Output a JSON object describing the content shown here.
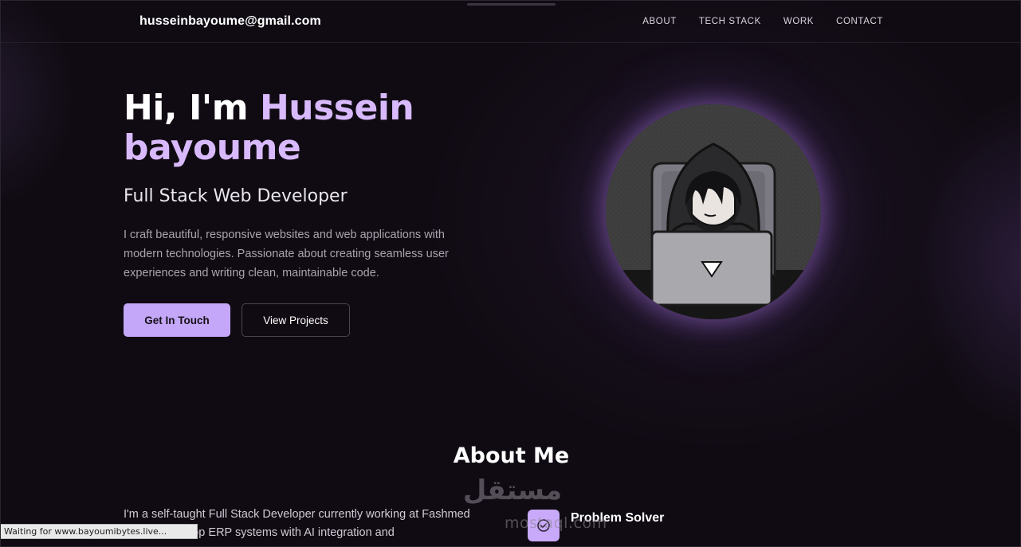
{
  "header": {
    "brand": "husseinbayoume@gmail.com",
    "nav": [
      "ABOUT",
      "TECH STACK",
      "WORK",
      "CONTACT"
    ]
  },
  "hero": {
    "greeting": "Hi, I'm ",
    "name_first": "Hussein",
    "name_last": "bayoume",
    "subtitle": "Full Stack Web Developer",
    "intro": "I craft beautiful, responsive websites and web applications with modern technologies. Passionate about creating seamless user experiences and writing clean, maintainable code.",
    "primary_button": "Get In Touch",
    "secondary_button": "View Projects",
    "avatar_icon": "hooded-developer-laptop-illustration"
  },
  "about": {
    "heading": "About Me",
    "text": "I'm a self-taught Full Stack Developer currently working at Fashmed where I develop ERP systems with AI integration and",
    "feature": {
      "icon": "check-circle-icon",
      "title": "Problem Solver"
    }
  },
  "watermark": {
    "arabic": "مستقل",
    "latin": "mostaql.com"
  },
  "status_bar": "Waiting for www.bayoumibytes.live...",
  "colors": {
    "accent": "#c4a7f8",
    "background": "#100b13"
  }
}
